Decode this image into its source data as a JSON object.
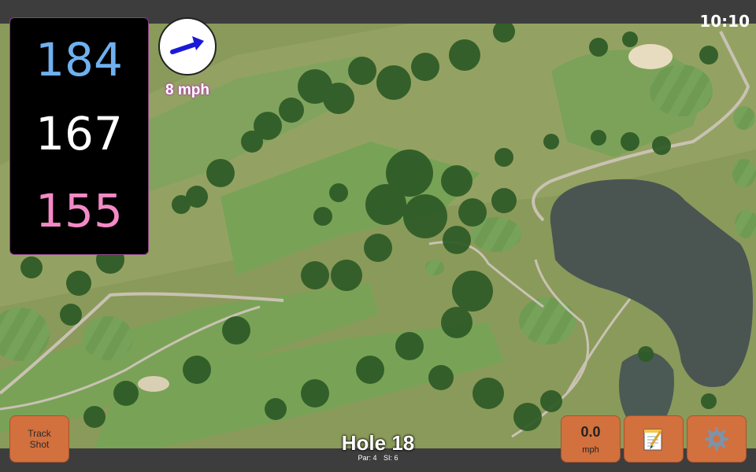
{
  "status": {
    "clock": "10:10"
  },
  "distances": {
    "back": "184",
    "center": "167",
    "front": "155"
  },
  "wind": {
    "speed_label": "8 mph",
    "direction_icon": "wind-arrow-icon"
  },
  "buttons": {
    "track_shot": {
      "line1": "Track",
      "line2": "Shot"
    },
    "speed": {
      "value": "0.0",
      "unit": "mph"
    },
    "notes_icon": "notepad-icon",
    "settings_icon": "gear-icon"
  },
  "hole": {
    "title": "Hole 18",
    "par": "Par: 4",
    "si": "SI: 6"
  },
  "colors": {
    "back": "#6fb1ef",
    "center": "#ffffff",
    "front": "#f38ac6",
    "button": "#d2703e",
    "wind_arrow": "#1a1ad6"
  }
}
